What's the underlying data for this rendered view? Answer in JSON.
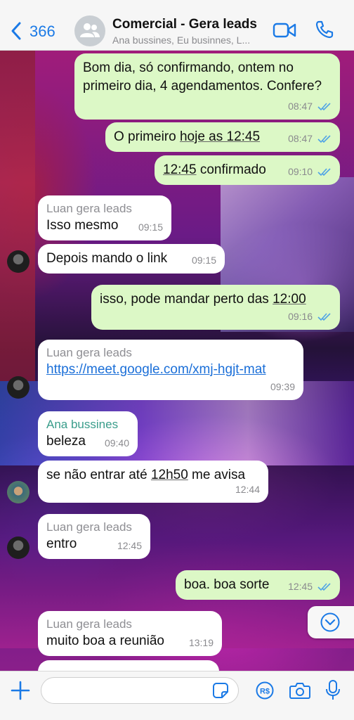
{
  "header": {
    "back_count": "366",
    "title": "Comercial - Gera leads",
    "subtitle": "Ana bussines, Eu businnes, L..."
  },
  "messages": [
    {
      "direction": "out",
      "text": "Bom dia, só confirmando, ontem no primeiro dia, 4 agendamentos. Confere?",
      "time": "08:47",
      "status": "read"
    },
    {
      "direction": "out",
      "text_parts": [
        "O primeiro ",
        "hoje as 12:45"
      ],
      "time": "08:47",
      "status": "read"
    },
    {
      "direction": "out",
      "text_parts": [
        "12:45",
        " confirmado"
      ],
      "time": "09:10",
      "status": "read"
    },
    {
      "direction": "in",
      "sender": "Luan gera leads",
      "text": "Isso mesmo",
      "time": "09:15"
    },
    {
      "direction": "in",
      "text": "Depois mando o link",
      "time": "09:15"
    },
    {
      "direction": "out",
      "text_parts": [
        "isso, pode mandar perto das ",
        "12:00"
      ],
      "time": "09:16",
      "status": "read"
    },
    {
      "direction": "in",
      "sender": "Luan gera leads",
      "text": "https://meet.google.com/xmj-hgjt-mat",
      "time": "09:39"
    },
    {
      "direction": "in",
      "sender": "Ana bussines",
      "text": "beleza",
      "time": "09:40"
    },
    {
      "direction": "in",
      "text_parts": [
        "se não entrar até ",
        "12h50",
        " me avisa"
      ],
      "time": "12:44"
    },
    {
      "direction": "in",
      "sender": "Luan gera leads",
      "text": "entro",
      "time": "12:45"
    },
    {
      "direction": "out",
      "text": "boa. boa sorte",
      "time": "12:45",
      "status": "read"
    },
    {
      "direction": "in",
      "sender": "Luan gera leads",
      "text": "muito boa a reunião",
      "time": "13:19"
    }
  ],
  "composer": {
    "placeholder": ""
  },
  "icons": {
    "back": "chevron-left-icon",
    "group": "group-avatar-icon",
    "video": "video-camera-icon",
    "call": "phone-icon",
    "scroll": "chevron-down-circle-icon",
    "plus": "plus-icon",
    "sticker": "sticker-icon",
    "pay": "pix-payment-icon",
    "camera": "camera-icon",
    "mic": "microphone-icon"
  },
  "colors": {
    "accent": "#1b7ae6",
    "outgoing_bubble": "#dcf8c6",
    "incoming_bubble": "#ffffff",
    "read_ticks": "#4fa3e6",
    "ana_sender": "#3a9d8b"
  }
}
